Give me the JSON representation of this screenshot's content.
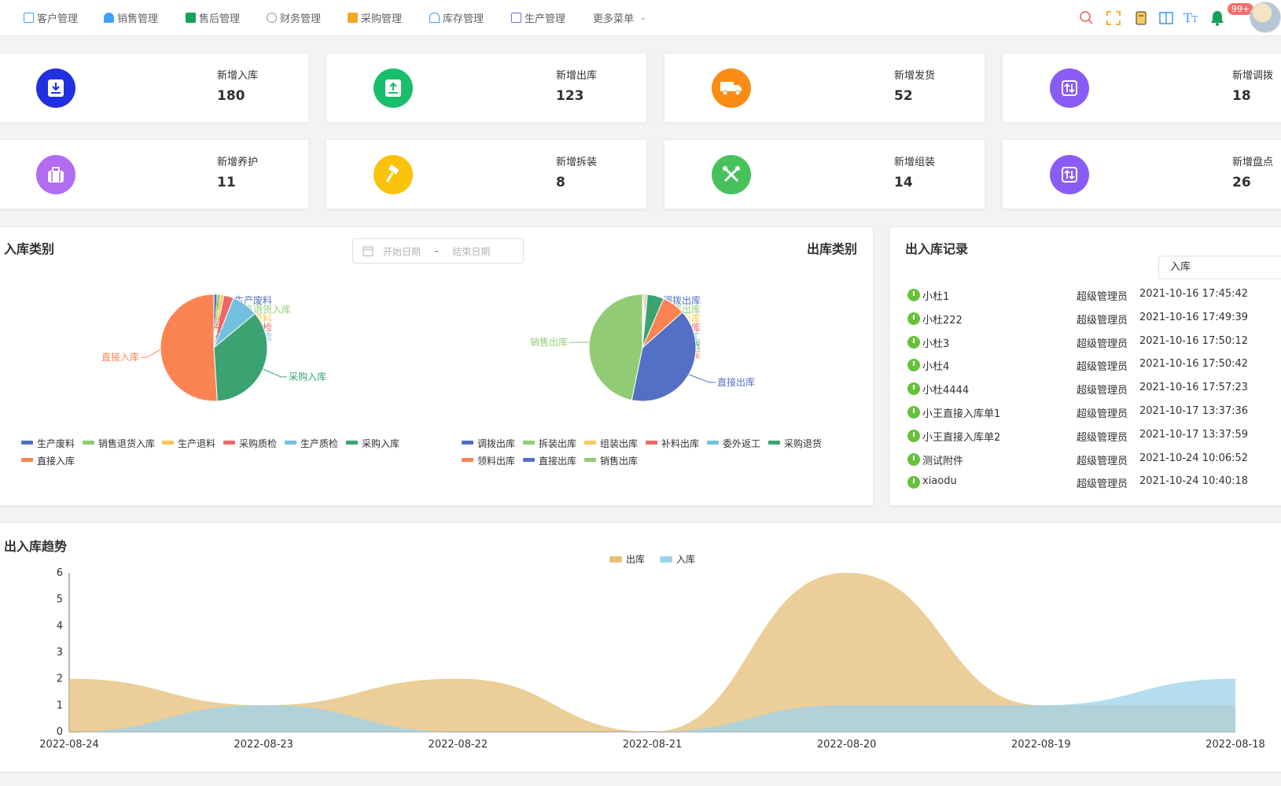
{
  "nav": {
    "items": [
      {
        "label": "客户管理",
        "icon": "customer-icon",
        "color": "#409eff"
      },
      {
        "label": "销售管理",
        "icon": "user-icon",
        "color": "#409eff"
      },
      {
        "label": "售后管理",
        "icon": "service-icon",
        "color": "#13a35a"
      },
      {
        "label": "财务管理",
        "icon": "finance-icon",
        "color": "#909399"
      },
      {
        "label": "采购管理",
        "icon": "cart-icon",
        "color": "#f5a623"
      },
      {
        "label": "库存管理",
        "icon": "warehouse-icon",
        "color": "#409eff"
      },
      {
        "label": "生产管理",
        "icon": "factory-icon",
        "color": "#7b61ff"
      }
    ],
    "more_label": "更多菜单",
    "badge": "99+"
  },
  "stats": [
    {
      "label": "新增入库",
      "value": "180",
      "color": "#2130e0",
      "icon": "stock-in-icon"
    },
    {
      "label": "新增出库",
      "value": "123",
      "color": "#19be6b",
      "icon": "stock-out-icon"
    },
    {
      "label": "新增发货",
      "value": "52",
      "color": "#fa8c16",
      "icon": "truck-icon"
    },
    {
      "label": "新增调拨",
      "value": "18",
      "color": "#8a5cf6",
      "icon": "transfer-icon"
    },
    {
      "label": "新增养护",
      "value": "11",
      "color": "#b26cf0",
      "icon": "briefcase-icon"
    },
    {
      "label": "新增拆装",
      "value": "8",
      "color": "#fac20a",
      "icon": "hammer-icon"
    },
    {
      "label": "新增组装",
      "value": "14",
      "color": "#47c15c",
      "icon": "tools-icon"
    },
    {
      "label": "新增盘点",
      "value": "26",
      "color": "#8a5cf6",
      "icon": "inventory-icon"
    }
  ],
  "inbound": {
    "title": "入库类别"
  },
  "outbound": {
    "title": "出库类别"
  },
  "date_range": {
    "start": "开始日期",
    "sep": "-",
    "end": "结束日期"
  },
  "records": {
    "title": "出入库记录",
    "select_value": "入库",
    "rows": [
      {
        "name": "小杜1",
        "user": "超级管理员",
        "time": "2021-10-16 17:45:42"
      },
      {
        "name": "小杜222",
        "user": "超级管理员",
        "time": "2021-10-16 17:49:39"
      },
      {
        "name": "小杜3",
        "user": "超级管理员",
        "time": "2021-10-16 17:50:12"
      },
      {
        "name": "小杜4",
        "user": "超级管理员",
        "time": "2021-10-16 17:50:42"
      },
      {
        "name": "小杜4444",
        "user": "超级管理员",
        "time": "2021-10-16 17:57:23"
      },
      {
        "name": "小王直接入库单1",
        "user": "超级管理员",
        "time": "2021-10-17 13:37:36"
      },
      {
        "name": "小王直接入库单2",
        "user": "超级管理员",
        "time": "2021-10-17 13:37:59"
      },
      {
        "name": "测试附件",
        "user": "超级管理员",
        "time": "2021-10-24 10:06:52"
      },
      {
        "name": "xiaodu",
        "user": "超级管理员",
        "time": "2021-10-24 10:40:18"
      }
    ]
  },
  "trend": {
    "title": "出入库趋势"
  },
  "chart_data": [
    {
      "type": "pie",
      "title": "入库类别",
      "legend_position": "bottom-left",
      "slices": [
        {
          "name": "生产废料",
          "value": 1,
          "color": "#5470c6"
        },
        {
          "name": "销售退货入库",
          "value": 1,
          "color": "#91cc75"
        },
        {
          "name": "生产退料",
          "value": 1,
          "color": "#fac858"
        },
        {
          "name": "采购质检",
          "value": 3,
          "color": "#ee6666"
        },
        {
          "name": "生产质检",
          "value": 8,
          "color": "#73c0de"
        },
        {
          "name": "采购入库",
          "value": 35,
          "color": "#3ba272"
        },
        {
          "name": "直接入库",
          "value": 51,
          "color": "#fc8452"
        }
      ]
    },
    {
      "type": "pie",
      "title": "出库类别",
      "legend_position": "bottom-left",
      "slices": [
        {
          "name": "调拨出库",
          "value": 0.3,
          "color": "#5470c6"
        },
        {
          "name": "拆装出库",
          "value": 0.3,
          "color": "#91cc75"
        },
        {
          "name": "组装出库",
          "value": 0.3,
          "color": "#fac858"
        },
        {
          "name": "补料出库",
          "value": 0.3,
          "color": "#ee6666"
        },
        {
          "name": "委外返工",
          "value": 0.3,
          "color": "#73c0de"
        },
        {
          "name": "采购退货",
          "value": 5,
          "color": "#3ba272"
        },
        {
          "name": "领料出库",
          "value": 7,
          "color": "#fc8452"
        },
        {
          "name": "直接出库",
          "value": 40,
          "color": "#5470c6"
        },
        {
          "name": "销售出库",
          "value": 47,
          "color": "#91cc75"
        }
      ]
    },
    {
      "type": "area",
      "title": "出入库趋势",
      "legend_position": "top-center",
      "x": [
        "2022-08-24",
        "2022-08-23",
        "2022-08-22",
        "2022-08-21",
        "2022-08-20",
        "2022-08-19",
        "2022-08-18"
      ],
      "ylim": [
        0,
        6
      ],
      "yticks": [
        0,
        1,
        2,
        3,
        4,
        5,
        6
      ],
      "series": [
        {
          "name": "出库",
          "values": [
            2,
            1,
            2,
            0,
            6,
            1,
            1
          ],
          "color": "#e5c07b"
        },
        {
          "name": "入库",
          "values": [
            0,
            1,
            0,
            0,
            1,
            1,
            2
          ],
          "color": "#9fd3ea"
        }
      ]
    }
  ]
}
